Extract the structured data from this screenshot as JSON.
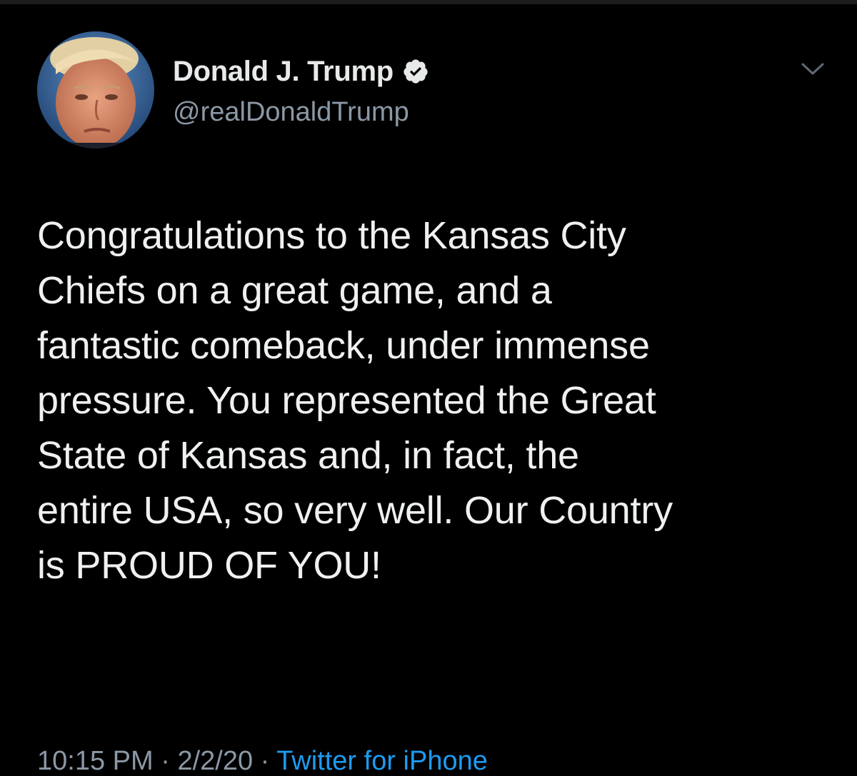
{
  "tweet": {
    "author": {
      "display_name": "Donald J. Trump",
      "handle": "@realDonaldTrump",
      "verified": true,
      "verified_icon": "verified-badge-icon"
    },
    "menu_icon": "chevron-down-icon",
    "text_lines": [
      "Congratulations to the Kansas City",
      "Chiefs on a great game, and a",
      "fantastic comeback, under immense",
      "pressure. You represented the Great",
      "State of Kansas and, in fact, the",
      "entire USA, so very well. Our Country",
      "is PROUD OF YOU!"
    ],
    "meta": {
      "time": "10:15 PM",
      "separator": " · ",
      "date": "2/2/20",
      "source": "Twitter for iPhone"
    }
  },
  "colors": {
    "background": "#000000",
    "text_primary": "#e7e9ea",
    "text_secondary": "#8b98a5",
    "link": "#1d9bf0"
  }
}
